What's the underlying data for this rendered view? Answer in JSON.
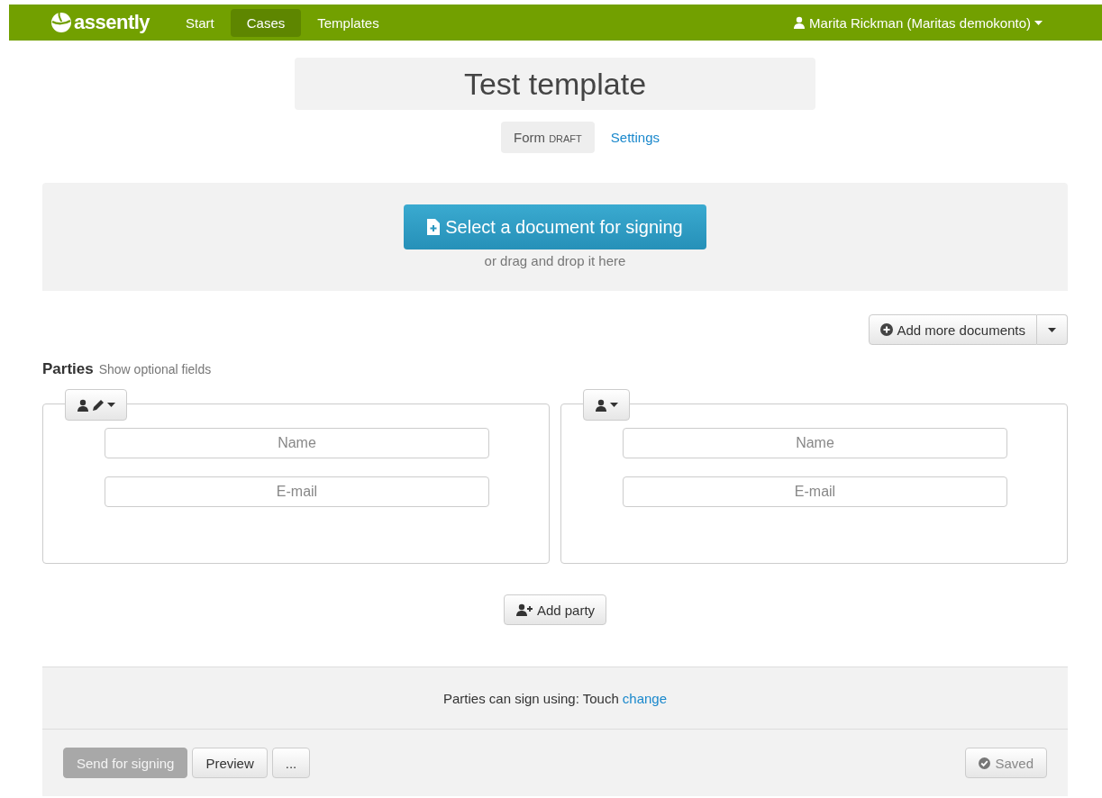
{
  "navbar": {
    "logo": "assently",
    "items": [
      {
        "label": "Start",
        "selected": false
      },
      {
        "label": "Cases",
        "selected": true
      },
      {
        "label": "Templates",
        "selected": false
      }
    ],
    "user": "Marita Rickman (Maritas demokonto)"
  },
  "title": "Test template",
  "tabs": [
    {
      "label": "Form",
      "badge": "DRAFT",
      "selected": true
    },
    {
      "label": "Settings",
      "selected": false
    }
  ],
  "upload": {
    "button": "Select a document for signing",
    "hint": "or drag and drop it here"
  },
  "add_documents": {
    "label": "Add more documents"
  },
  "parties": {
    "heading": "Parties",
    "optional_link": "Show optional fields",
    "items": [
      {
        "kind": "editor",
        "fields": [
          {
            "placeholder": "Name"
          },
          {
            "placeholder": "E-mail"
          }
        ]
      },
      {
        "kind": "signer",
        "fields": [
          {
            "placeholder": "Name"
          },
          {
            "placeholder": "E-mail"
          }
        ]
      }
    ],
    "add_button": "Add party"
  },
  "signing_method": {
    "text": "Parties can sign using: Touch",
    "link": "change"
  },
  "footer": {
    "buttons": [
      {
        "label": "Send for signing",
        "kind": "primary",
        "disabled": true
      },
      {
        "label": "Preview",
        "kind": "default",
        "disabled": false
      },
      {
        "label": "...",
        "kind": "default",
        "disabled": false
      }
    ],
    "status": {
      "label": "Saved",
      "disabled": true
    }
  }
}
